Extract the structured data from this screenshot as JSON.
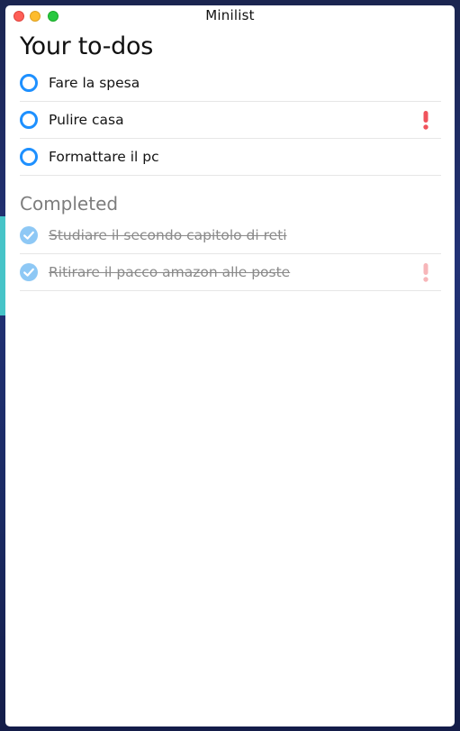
{
  "window": {
    "title": "Minilist"
  },
  "todos": {
    "heading": "Your to-dos",
    "items": [
      {
        "label": "Fare la spesa",
        "important": false
      },
      {
        "label": "Pulire casa",
        "important": true
      },
      {
        "label": "Formattare il pc",
        "important": false
      }
    ]
  },
  "completed": {
    "heading": "Completed",
    "items": [
      {
        "label": "Studiare il secondo capitolo di reti",
        "important": false
      },
      {
        "label": "Ritirare il pacco amazon alle poste",
        "important": true
      }
    ]
  },
  "icons": {
    "open_check": "circle-icon",
    "done_check": "check-circle-icon",
    "priority": "exclamation-icon"
  },
  "colors": {
    "accent": "#1e90ff",
    "done_check": "#8ec8f5",
    "priority": "#f0535c",
    "priority_done": "#f7b6b9",
    "completed_text": "#8a8a8a"
  }
}
